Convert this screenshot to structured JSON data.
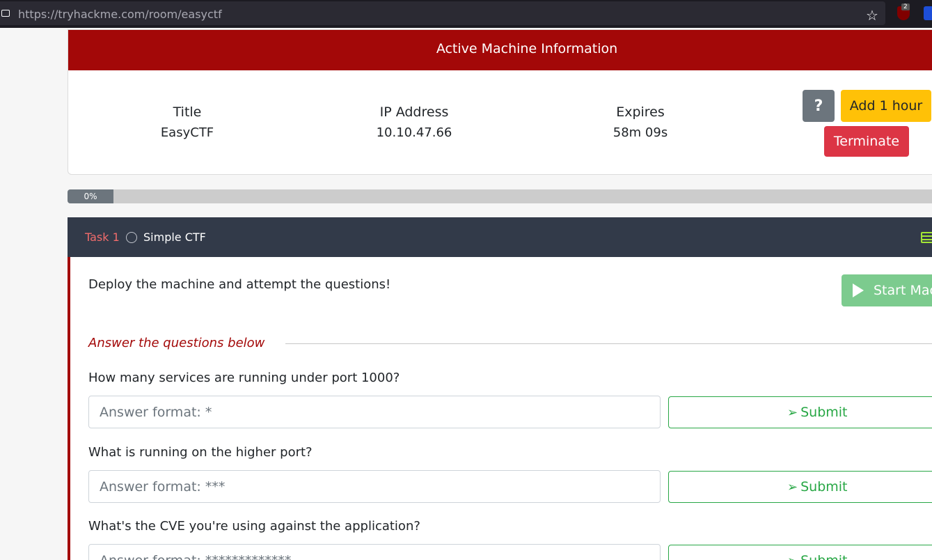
{
  "browser": {
    "url_host": "https://tryhackme.com",
    "url_path": "/room/easyctf",
    "extension_badge": "2"
  },
  "machine": {
    "header": "Active Machine Information",
    "title_label": "Title",
    "title_value": "EasyCTF",
    "ip_label": "IP Address",
    "ip_value": "10.10.47.66",
    "expires_label": "Expires",
    "expires_value": "58m 09s",
    "help_label": "?",
    "add_hour_label": "Add 1 hour",
    "terminate_label": "Terminate"
  },
  "progress": {
    "label": "0%",
    "value": 0
  },
  "task": {
    "number": "Task 1",
    "title": "Simple CTF",
    "description": "Deploy the machine and attempt the questions!",
    "start_label": "Start Machine",
    "answer_heading": "Answer the questions below",
    "submit_label": "Submit",
    "questions": [
      {
        "text": "How many services are running under port 1000?",
        "placeholder": "Answer format: *"
      },
      {
        "text": "What is running on the higher port?",
        "placeholder": "Answer format: ***"
      },
      {
        "text": "What's the CVE you're using against the application?",
        "placeholder": "Answer format: *************"
      }
    ]
  },
  "colors": {
    "header_red": "#a30808",
    "task_header": "#323a49",
    "submit_green": "#28a745",
    "warning": "#ffc107",
    "danger": "#dc3545"
  }
}
